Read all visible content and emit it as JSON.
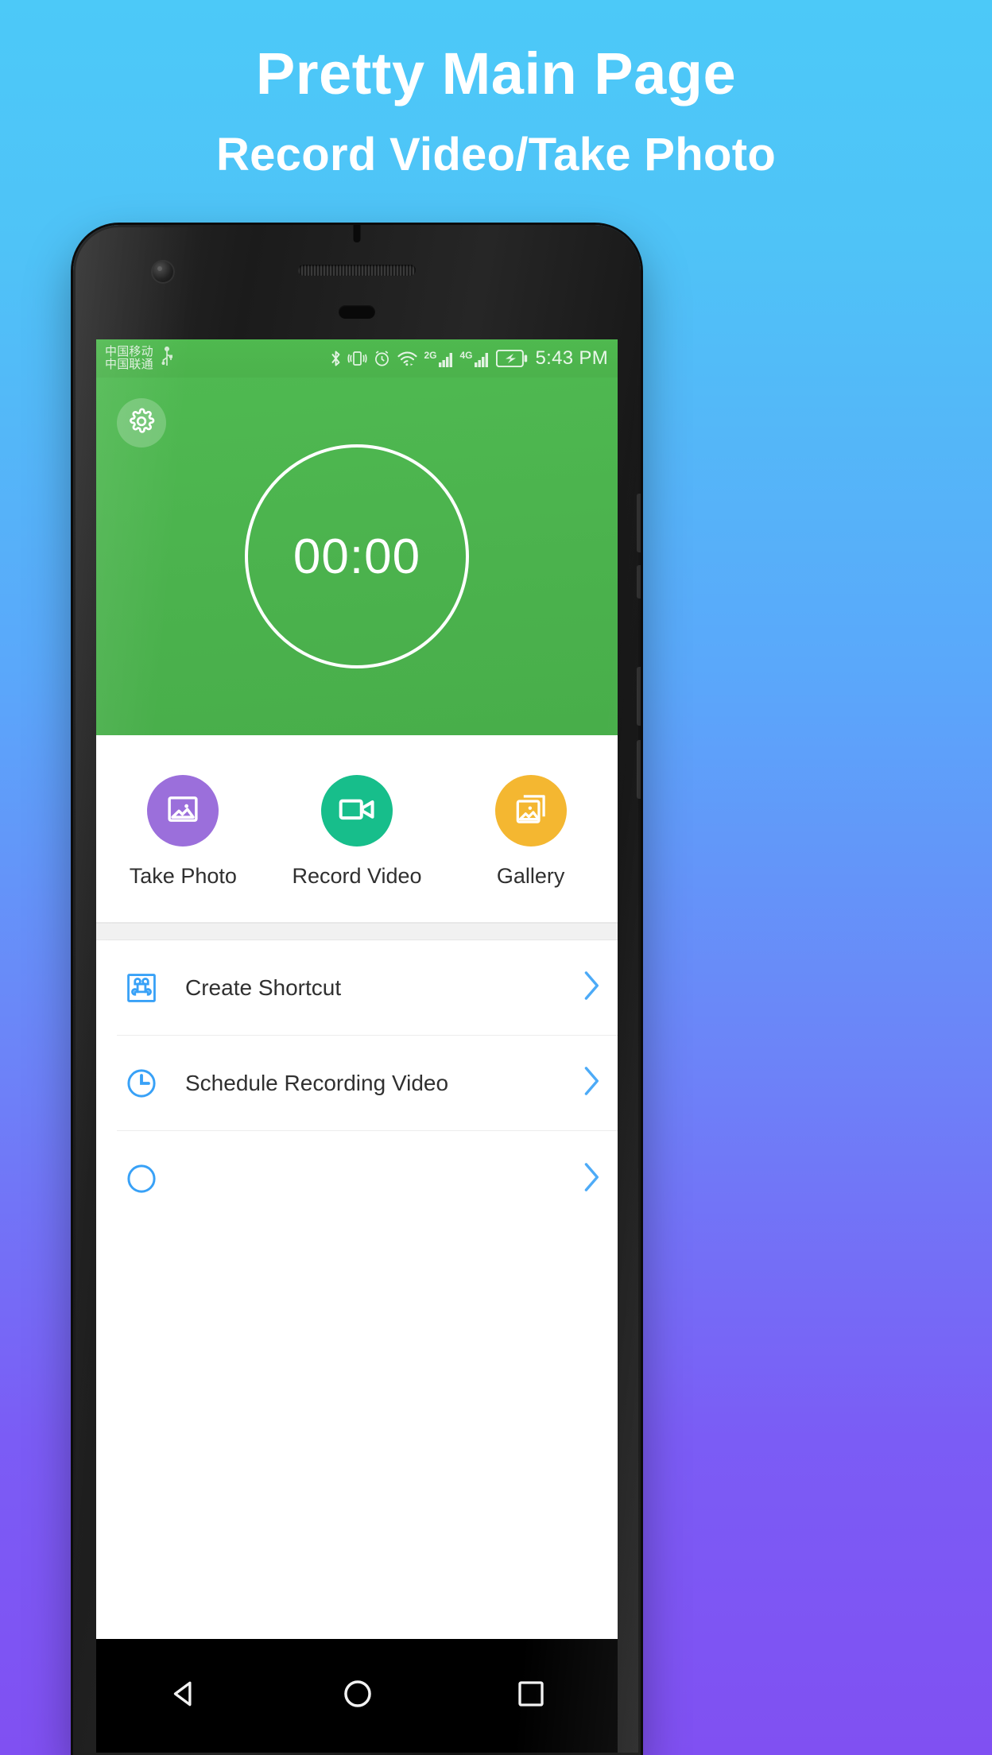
{
  "promo": {
    "title": "Pretty Main Page",
    "subtitle": "Record Video/Take Photo"
  },
  "colors": {
    "background_top": "#4CC9F8",
    "background_bottom": "#8050F2",
    "hero_green": "#4CB24C",
    "status_bar_green": "#4FB94F",
    "take_photo_purple": "#9B6FDB",
    "record_video_green": "#17BE8B",
    "gallery_orange": "#F4B731",
    "list_icon_blue": "#38A1F7",
    "chevron_blue": "#38A1F7",
    "text_primary": "#303030"
  },
  "phone": {
    "statusbar": {
      "carrier_line1": "中国移动",
      "carrier_line2": "中国联通",
      "icons": [
        "usb-icon",
        "bluetooth-icon",
        "vibrate-icon",
        "alarm-icon",
        "wifi-icon"
      ],
      "network_1_label": "2G",
      "network_2_label": "4G",
      "battery": "battery-charging-icon",
      "time": "5:43 PM"
    },
    "hero": {
      "settings_icon": "gear-icon",
      "timer": "00:00"
    },
    "quick_actions": [
      {
        "label": "Take Photo",
        "icon": "image-icon",
        "color": "#9B6FDB"
      },
      {
        "label": "Record Video",
        "icon": "video-camera-icon",
        "color": "#17BE8B"
      },
      {
        "label": "Gallery",
        "icon": "gallery-icon",
        "color": "#F4B731"
      }
    ],
    "list_items": [
      {
        "label": "Create Shortcut",
        "icon": "shortcut-icon"
      },
      {
        "label": "Schedule Recording Video",
        "icon": "clock-icon"
      }
    ],
    "navbar": {
      "back": "back-triangle-icon",
      "home": "home-circle-icon",
      "recents": "recents-square-icon"
    }
  }
}
